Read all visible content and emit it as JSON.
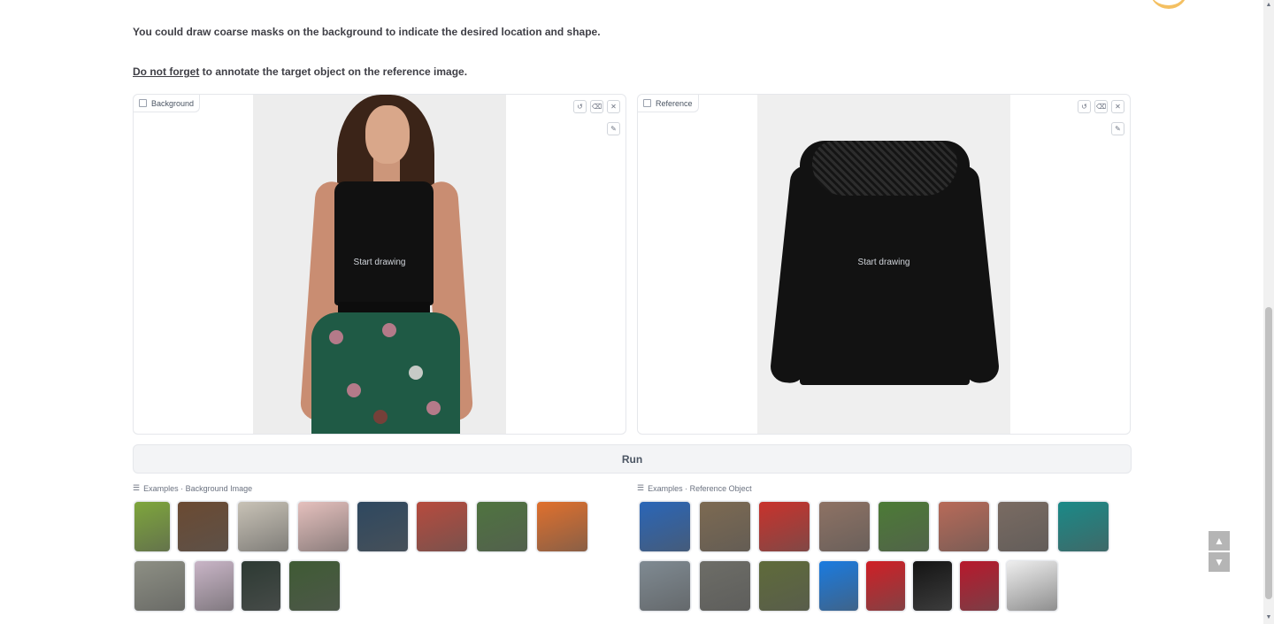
{
  "intro": {
    "line1": "You could draw coarse masks on the background to indicate the desired location and shape.",
    "line2_link": "Do not forget",
    "line2_rest": " to annotate the target object on the reference image."
  },
  "background_panel": {
    "label": "Background",
    "hint": "Start drawing",
    "tools": [
      "undo-icon",
      "erase-icon",
      "close-icon"
    ],
    "brush": "brush-icon"
  },
  "reference_panel": {
    "label": "Reference",
    "hint": "Start drawing",
    "tools": [
      "undo-icon",
      "erase-icon",
      "close-icon"
    ],
    "brush": "brush-icon"
  },
  "run_button": "Run",
  "examples_background": {
    "title": "Examples · Background Image",
    "thumb_colors": [
      "#7ea63c",
      "#6b4a32",
      "#c8c2b6",
      "#e5c0bd",
      "#2e4860",
      "#b74b3e",
      "#4f7440",
      "#e0702d",
      "#8d8f84",
      "#c9b5c7",
      "#2d3a33",
      "#3f5b34"
    ]
  },
  "examples_reference": {
    "title": "Examples · Reference Object",
    "thumb_colors": [
      "#2a66b8",
      "#7d6a52",
      "#c9322c",
      "#8e7264",
      "#4c7b36",
      "#b86a58",
      "#7a6b62",
      "#1a8a88",
      "#7f8a92",
      "#6d6d67",
      "#5f6b3a",
      "#1a7be0",
      "#d01f26",
      "#141414",
      "#b8182c",
      "#eeeeee"
    ]
  },
  "scroll": {
    "up": "▲",
    "down": "▼"
  }
}
